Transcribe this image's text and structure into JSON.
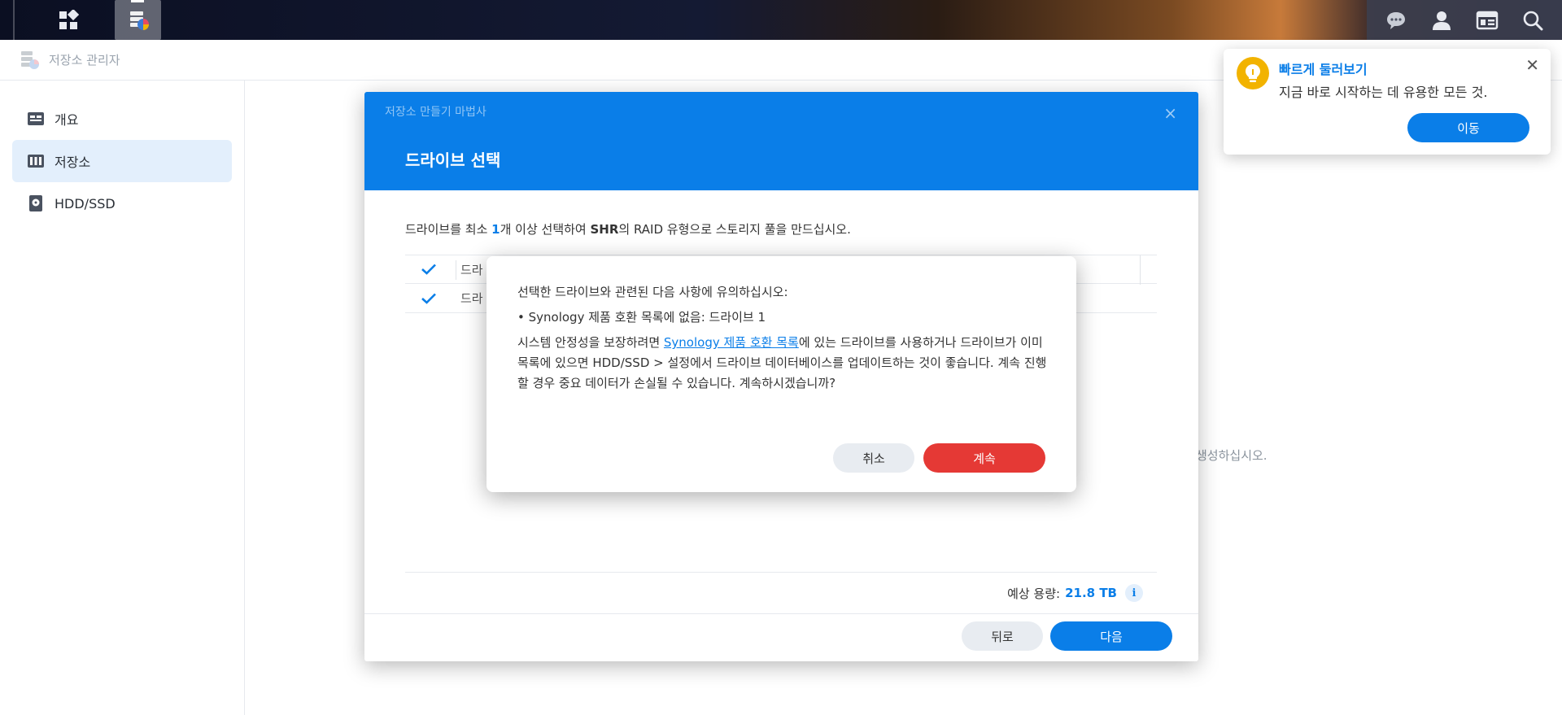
{
  "app": {
    "title": "저장소 관리자"
  },
  "sidebar": {
    "items": [
      {
        "label": "개요",
        "icon": "overview-icon"
      },
      {
        "label": "저장소",
        "icon": "storage-icon"
      },
      {
        "label": "HDD/SSD",
        "icon": "hdd-icon"
      }
    ]
  },
  "background": {
    "hint_text": "생성하십시오."
  },
  "wizard": {
    "small_title": "저장소 만들기 마법사",
    "title": "드라이브 선택",
    "desc_prefix": "드라이브를 최소 ",
    "desc_count": "1",
    "desc_mid": "개 이상 선택하여 ",
    "desc_shr": "SHR",
    "desc_suffix": "의 RAID 유형으로 스토리지 풀을 만드십시오.",
    "table": {
      "header_cell": "드라",
      "row_cell": "드라"
    },
    "capacity_label": "예상 용량:",
    "capacity_value": "21.8 TB",
    "info_glyph": "i",
    "back_label": "뒤로",
    "next_label": "다음",
    "close_glyph": "×"
  },
  "confirm": {
    "heading": "선택한 드라이브와 관련된 다음 사항에 유의하십시오:",
    "bullet": "• Synology 제품 호환 목록에 없음: 드라이브 1",
    "para_prefix": "시스템 안정성을 보장하려면 ",
    "para_link": "Synology 제품 호환 목록",
    "para_suffix": "에 있는 드라이브를 사용하거나 드라이브가 이미 목록에 있으면 HDD/SSD > 설정에서 드라이브 데이터베이스를 업데이트하는 것이 좋습니다. 계속 진행할 경우 중요 데이터가 손실될 수 있습니다. 계속하시겠습니까?",
    "cancel_label": "취소",
    "continue_label": "계속"
  },
  "tour": {
    "title": "빠르게 둘러보기",
    "text": "지금 바로 시작하는 데 유용한 모든 것.",
    "go_label": "이동",
    "close_glyph": "✕"
  },
  "colors": {
    "accent": "#0a7ee8",
    "danger": "#e53935",
    "tour_icon": "#f2b300"
  }
}
